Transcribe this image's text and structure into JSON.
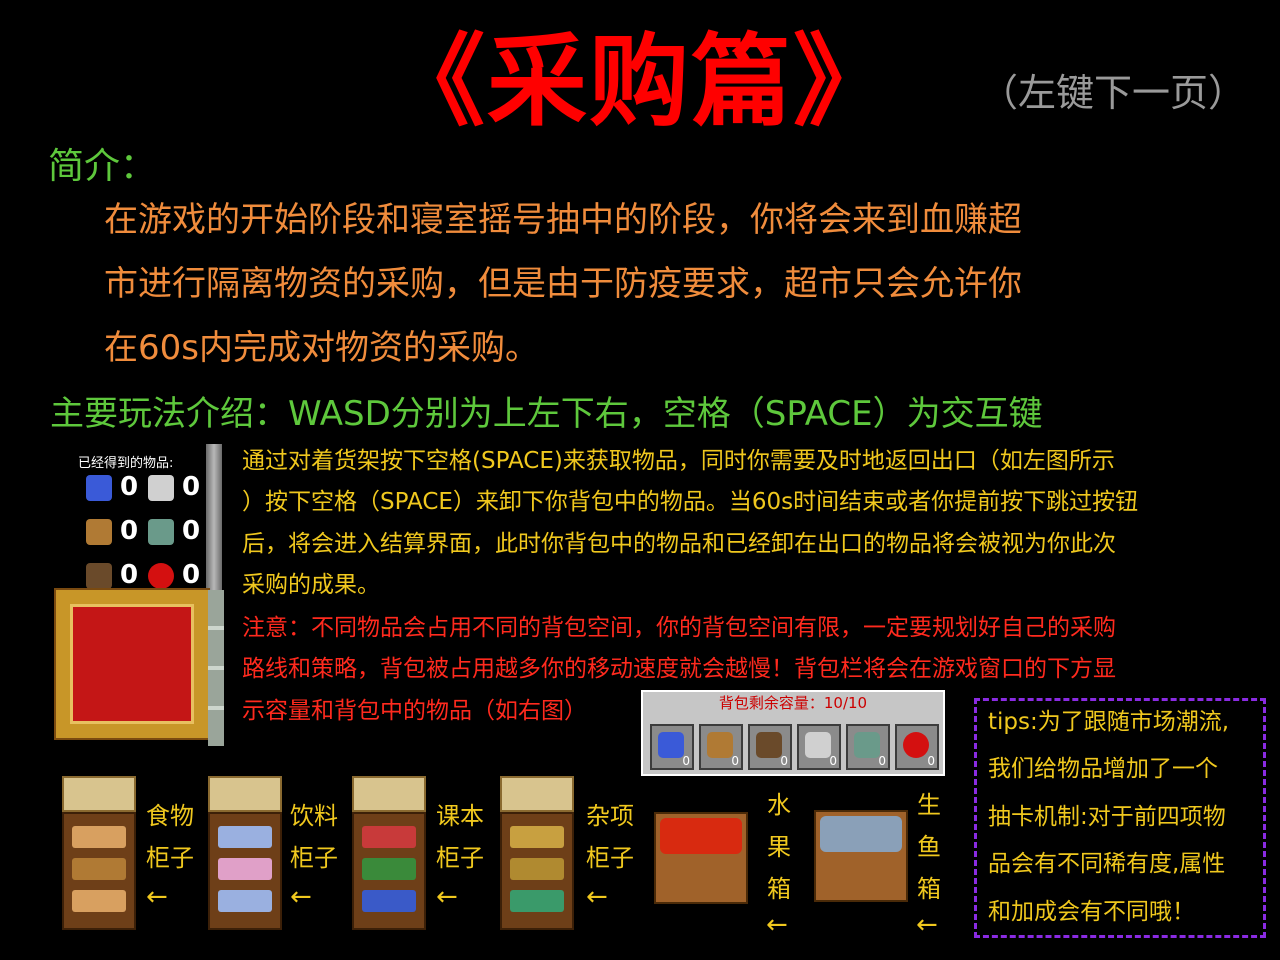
{
  "title": "《采购篇》",
  "page_hint": "（左键下一页）",
  "intro": {
    "heading": "简介：",
    "lines": [
      "在游戏的开始阶段和寝室摇号抽中的阶段，你将会来到血赚超",
      "市进行隔离物资的采购，但是由于防疫要求，超市只会允许你",
      "在60s内完成对物资的采购。"
    ]
  },
  "howto": {
    "heading": "主要玩法介绍：WASD分别为上左下右，空格（SPACE）为交互键",
    "yellow_lines": [
      "通过对着货架按下空格(SPACE)来获取物品，同时你需要及时地返回出口（如左图所示",
      "）按下空格（SPACE）来卸下你背包中的物品。当60s时间结束或者你提前按下跳过按钮",
      "后，将会进入结算界面，此时你背包中的物品和已经卸在出口的物品将会被视为你此次",
      "采购的成果。"
    ],
    "red_lines": [
      "注意：不同物品会占用不同的背包空间，你的背包空间有限，一定要规划好自己的采购",
      "路线和策略，背包被占用越多你的移动速度就会越慢！背包栏将会在游戏窗口的下方显",
      "示容量和背包中的物品（如右图）"
    ]
  },
  "collected_panel": {
    "title": "已经得到的物品:",
    "items": [
      {
        "icon": "potion-icon",
        "count": "0"
      },
      {
        "icon": "bucket-icon",
        "count": "0"
      },
      {
        "icon": "bread-icon",
        "count": "0"
      },
      {
        "icon": "fish-icon",
        "count": "0"
      },
      {
        "icon": "book-icon",
        "count": "0"
      },
      {
        "icon": "apple-icon",
        "count": "0"
      }
    ]
  },
  "backpack": {
    "label": "背包剩余容量：10/10",
    "slots": [
      {
        "icon": "potion-icon",
        "count": "0",
        "color": "#3a5ad8"
      },
      {
        "icon": "bread-icon",
        "count": "0",
        "color": "#b07a34"
      },
      {
        "icon": "book-icon",
        "count": "0",
        "color": "#6a4a2a"
      },
      {
        "icon": "bucket-icon",
        "count": "0",
        "color": "#d0d0d0"
      },
      {
        "icon": "fish-icon",
        "count": "0",
        "color": "#6a9a8a"
      },
      {
        "icon": "apple-icon",
        "count": "0",
        "color": "#d41010"
      }
    ]
  },
  "tips": [
    "tips:为了跟随市场潮流,",
    "我们给物品增加了一个",
    "抽卡机制:对于前四项物",
    "品会有不同稀有度,属性",
    "和加成会有不同哦！"
  ],
  "shelves": [
    {
      "line1": "食物",
      "line2": "柜子",
      "arrow": "←",
      "color": "#d8a060"
    },
    {
      "line1": "饮料",
      "line2": "柜子",
      "arrow": "←",
      "color": "#9ab0e0"
    },
    {
      "line1": "课本",
      "line2": "柜子",
      "arrow": "←",
      "color": "#c83a3a"
    },
    {
      "line1": "杂项",
      "line2": "柜子",
      "arrow": "←",
      "color": "#c8a040"
    }
  ],
  "crates": [
    {
      "chars": [
        "水",
        "果",
        "箱"
      ],
      "arrow": "←",
      "color": "#d82a10"
    },
    {
      "chars": [
        "生",
        "鱼",
        "箱"
      ],
      "arrow": "←",
      "color": "#8aa0b8"
    }
  ],
  "colors": {
    "title": "#ff0000",
    "heading": "#5ec83c",
    "intro": "#f08c3c",
    "body": "#f0c81e",
    "warning": "#ff2a1e",
    "tips_border": "#8a2be2"
  }
}
